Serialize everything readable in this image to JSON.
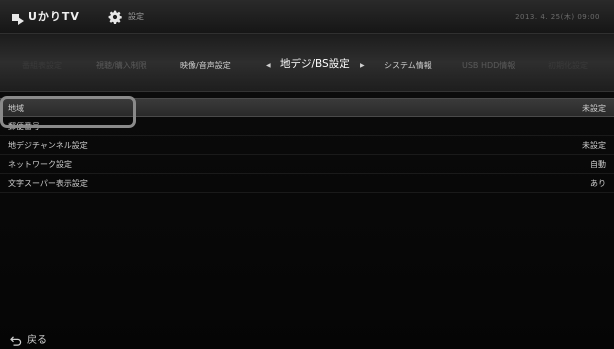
{
  "header": {
    "logo_text": "UかりTV",
    "section_title": "設定",
    "datetime": "2013. 4. 25(木)   09:00"
  },
  "tabs": {
    "items": [
      {
        "label": "番組表設定",
        "state": "dim2"
      },
      {
        "label": "視聴/購入制限",
        "state": "dim1"
      },
      {
        "label": "映像/音声設定",
        "state": "near"
      },
      {
        "label": "地デジ/BS設定",
        "state": "active"
      },
      {
        "label": "システム情報",
        "state": "near"
      },
      {
        "label": "USB HDD情報",
        "state": "dim1"
      },
      {
        "label": "初期化設定",
        "state": "dim2"
      }
    ],
    "prev_arrow": "◀",
    "next_arrow": "▶"
  },
  "settings_list": {
    "rows": [
      {
        "label": "地域",
        "value": "未設定",
        "selected": true
      },
      {
        "label": "郵便番号",
        "value": "",
        "selected": false
      },
      {
        "label": "地デジチャンネル設定",
        "value": "未設定",
        "selected": false
      },
      {
        "label": "ネットワーク設定",
        "value": "自動",
        "selected": false
      },
      {
        "label": "文字スーパー表示設定",
        "value": "あり",
        "selected": false
      }
    ]
  },
  "footer": {
    "back_label": "戻る",
    "back_icon": "return-arrow-icon"
  },
  "icons": {
    "settings": "gear-icon",
    "logo": "logo-icon"
  }
}
